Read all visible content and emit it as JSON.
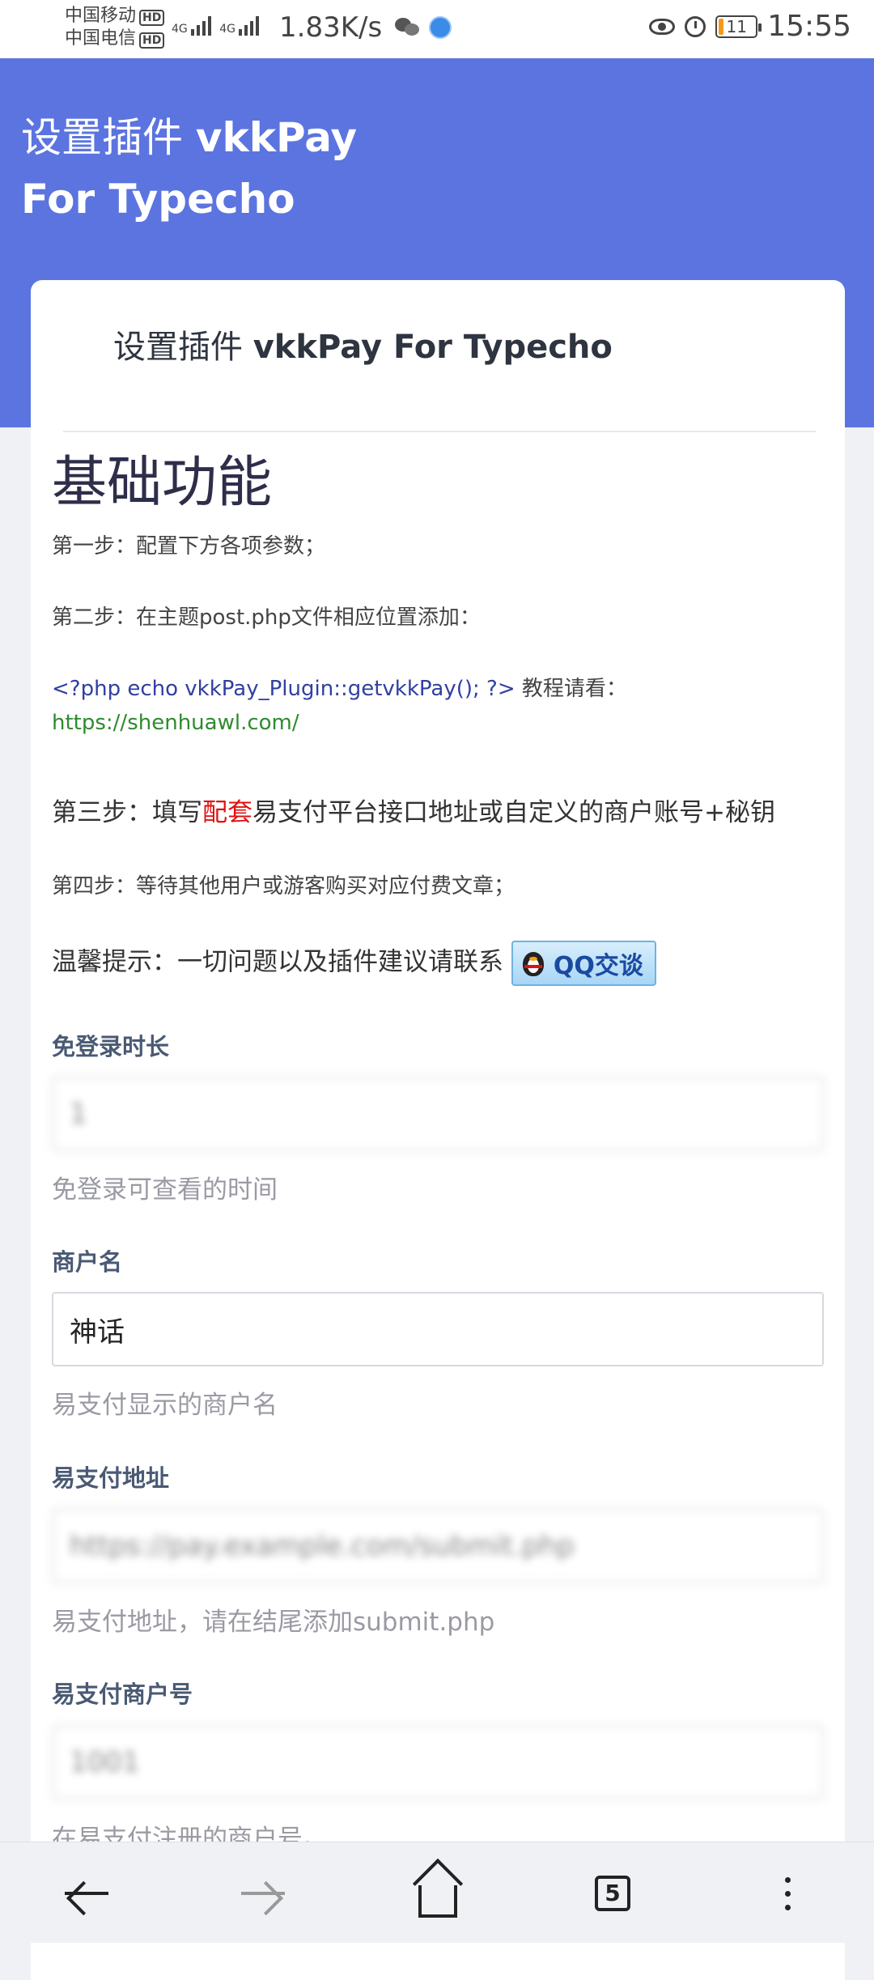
{
  "status_bar": {
    "carrier1": "中国移动",
    "carrier2": "中国电信",
    "hd_badge": "HD",
    "network_type": "4G",
    "speed": "1.83K/s",
    "battery": "11",
    "time": "15:55"
  },
  "header": {
    "title_prefix": "设置插件",
    "title_name": "vkkPay For Typecho"
  },
  "card": {
    "title_prefix": "设置插件",
    "title_name": "vkkPay For Typecho"
  },
  "instructions": {
    "section_title": "基础功能",
    "step1": "第一步：配置下方各项参数；",
    "step2": "第二步：在主题post.php文件相应位置添加：",
    "code": "<?php echo vkkPay_Plugin::getvkkPay(); ?>",
    "tutorial_label": "教程请看：",
    "tutorial_link": "https://shenhuawl.com/",
    "step3_prefix": "第三步：填写",
    "step3_highlight": "配套",
    "step3_suffix": "易支付平台接口地址或自定义的商户账号+秘钥",
    "step4": "第四步：等待其他用户或游客购买对应付费文章；",
    "tip": "温馨提示：一切问题以及插件建议请联系",
    "qq_button": "QQ交谈"
  },
  "fields": [
    {
      "label": "免登录时长",
      "value": "1",
      "help": "免登录可查看的时间",
      "blurred": true
    },
    {
      "label": "商户名",
      "value": "神话",
      "help": "易支付显示的商户名",
      "blurred": false
    },
    {
      "label": "易支付地址",
      "value": "https://pay.example.com/submit.php",
      "help": "易支付地址，请在结尾添加submit.php",
      "blurred": true
    },
    {
      "label": "易支付商户号",
      "value": "1001",
      "help": "在易支付注册的商户号。",
      "blurred": true
    }
  ],
  "bottom_nav": {
    "tab_count": "5"
  },
  "colors": {
    "header_bg": "#5b74e0",
    "highlight_red": "#e01010",
    "link_green": "#2e8b2e"
  }
}
